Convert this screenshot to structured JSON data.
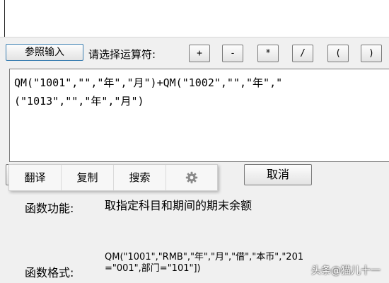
{
  "toolbar": {
    "ref_input_label": "参照输入",
    "operator_prompt": "请选择运算符:"
  },
  "operators": [
    "+",
    "-",
    "*",
    "/",
    "(",
    ")"
  ],
  "editor": {
    "line1": "QM(\"1001\",\"\",\"年\",\"月\")+QM(\"1002\",\"\",\"年\",\"",
    "line2": "(\"1013\",\"\",\"年\",\"月\")"
  },
  "context_menu": {
    "translate": "翻译",
    "copy": "复制",
    "search": "搜索",
    "settings_icon": "gear-icon"
  },
  "cancel_button": "取消",
  "function_info": {
    "func_label": "函数功能:",
    "func_desc": "取指定科目和期间的期末余额",
    "format_label": "函数格式:",
    "format_line1": "QM(\"1001\",\"RMB\",\"年\",\"月\",\"借\",\"本币\",\"201",
    "format_line2": "=\"001\",部门=\"101\"])"
  },
  "watermark": "头条@猫儿十一",
  "colors": {
    "frame_blue": "#3c7fb1",
    "background": "#f0f0f0"
  }
}
